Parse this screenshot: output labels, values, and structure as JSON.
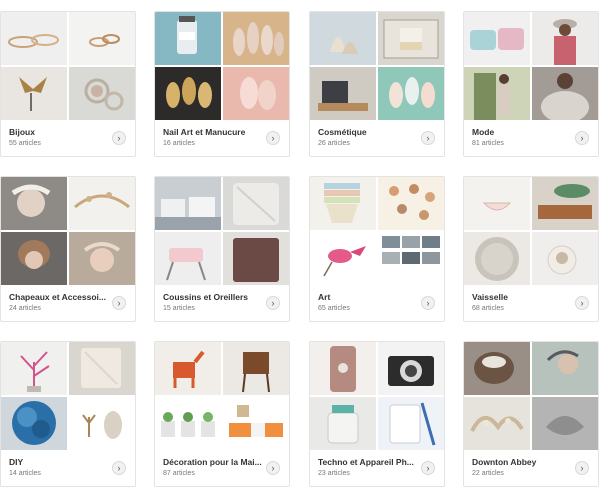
{
  "categories": [
    {
      "title": "Bijoux",
      "count": "55 articles"
    },
    {
      "title": "Nail Art et Manucure",
      "count": "16 articles"
    },
    {
      "title": "Cosmétique",
      "count": "26 articles"
    },
    {
      "title": "Mode",
      "count": "81 articles"
    },
    {
      "title": "Chapeaux et Accessoi...",
      "count": "24 articles"
    },
    {
      "title": "Coussins et Oreillers",
      "count": "15 articles"
    },
    {
      "title": "Art",
      "count": "65 articles"
    },
    {
      "title": "Vaisselle",
      "count": "68 articles"
    },
    {
      "title": "DIY",
      "count": "14 articles"
    },
    {
      "title": "Décoration pour la Mai...",
      "count": "87 articles"
    },
    {
      "title": "Techno et Appareil Ph...",
      "count": "23 articles"
    },
    {
      "title": "Downton Abbey",
      "count": "22 articles"
    }
  ],
  "icons": {
    "more": "chevron-right-icon"
  }
}
